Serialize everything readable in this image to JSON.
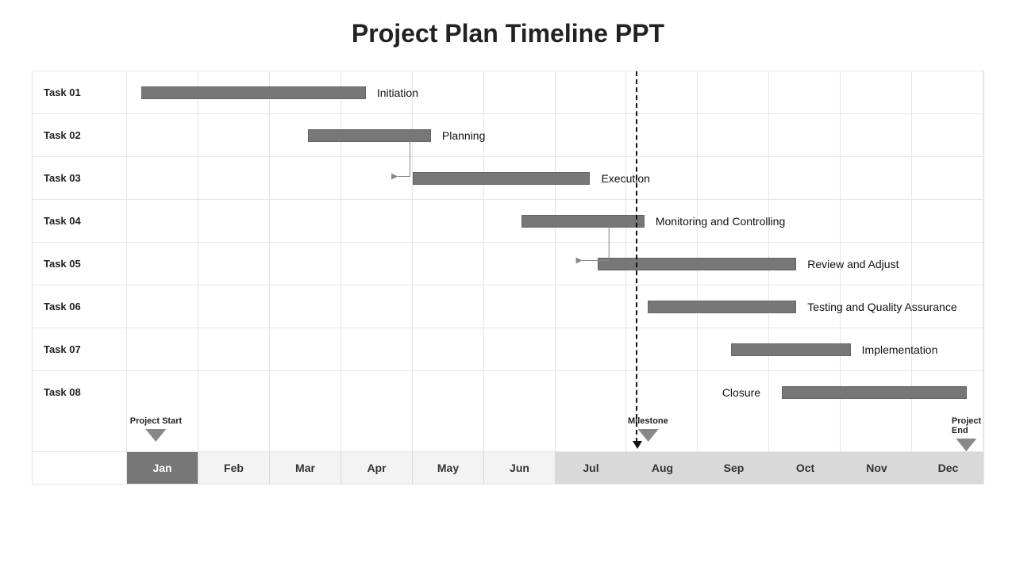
{
  "title": "Project Plan Timeline PPT",
  "months": [
    "Jan",
    "Feb",
    "Mar",
    "Apr",
    "May",
    "Jun",
    "Jul",
    "Aug",
    "Sep",
    "Oct",
    "Nov",
    "Dec"
  ],
  "tasks": [
    {
      "id": "Task 01",
      "label": "Initiation",
      "start": 0.2,
      "end": 3.3
    },
    {
      "id": "Task 02",
      "label": "Planning",
      "start": 2.5,
      "end": 4.2
    },
    {
      "id": "Task 03",
      "label": "Execution",
      "start": 3.95,
      "end": 6.4
    },
    {
      "id": "Task 04",
      "label": "Monitoring and Controlling",
      "start": 5.45,
      "end": 7.15
    },
    {
      "id": "Task 05",
      "label": "Review and Adjust",
      "start": 6.5,
      "end": 9.25
    },
    {
      "id": "Task 06",
      "label": "Testing and Quality Assurance",
      "start": 7.2,
      "end": 9.25
    },
    {
      "id": "Task 07",
      "label": "Implementation",
      "start": 8.35,
      "end": 10.0
    },
    {
      "id": "Task 08",
      "label": "Closure",
      "start": 9.05,
      "end": 11.6,
      "label_side": "left"
    }
  ],
  "markers": [
    {
      "label": "Project Start",
      "month": 0.4
    },
    {
      "label": "MIlestone",
      "month": 7.2
    },
    {
      "label": "Project End",
      "month": 11.6
    }
  ],
  "milestone_line": 7.2,
  "month_highlight": {
    "dark": [
      0
    ],
    "mid": [
      6,
      7,
      8,
      9,
      10,
      11
    ]
  },
  "chart_data": {
    "type": "bar",
    "orientation": "horizontal",
    "title": "Project Plan Timeline PPT",
    "xlabel": "Month",
    "ylabel": "Task",
    "categories": [
      "Jan",
      "Feb",
      "Mar",
      "Apr",
      "May",
      "Jun",
      "Jul",
      "Aug",
      "Sep",
      "Oct",
      "Nov",
      "Dec"
    ],
    "series": [
      {
        "name": "Task 01 Initiation",
        "start": "Jan",
        "end": "Apr"
      },
      {
        "name": "Task 02 Planning",
        "start": "Mar",
        "end": "May"
      },
      {
        "name": "Task 03 Execution",
        "start": "Apr",
        "end": "Jul"
      },
      {
        "name": "Task 04 Monitoring and Controlling",
        "start": "Jun",
        "end": "Aug"
      },
      {
        "name": "Task 05 Review and Adjust",
        "start": "Jul",
        "end": "Oct"
      },
      {
        "name": "Task 06 Testing and Quality Assurance",
        "start": "Aug",
        "end": "Oct"
      },
      {
        "name": "Task 07 Implementation",
        "start": "Sep",
        "end": "Oct"
      },
      {
        "name": "Task 08 Closure",
        "start": "Oct",
        "end": "Dec"
      }
    ],
    "annotations": [
      "Project Start",
      "MIlestone",
      "Project End"
    ]
  }
}
